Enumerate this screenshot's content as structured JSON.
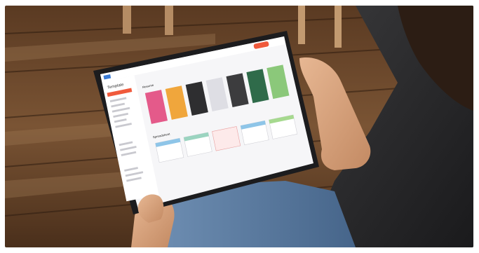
{
  "screen": {
    "logo": "Template",
    "sections": [
      {
        "heading": "Resume"
      },
      {
        "heading": "Spreadsheet"
      }
    ]
  },
  "colors": {
    "floor_dark": "#3b2516",
    "floor_mid": "#6e4a2e",
    "floor_light": "#9a7350",
    "tablet_bezel": "#1c1c1e",
    "accent": "#f05a3c",
    "shirt": "#2a2a2c",
    "jeans": "#5b7da3",
    "skin": "#d9a27c"
  }
}
